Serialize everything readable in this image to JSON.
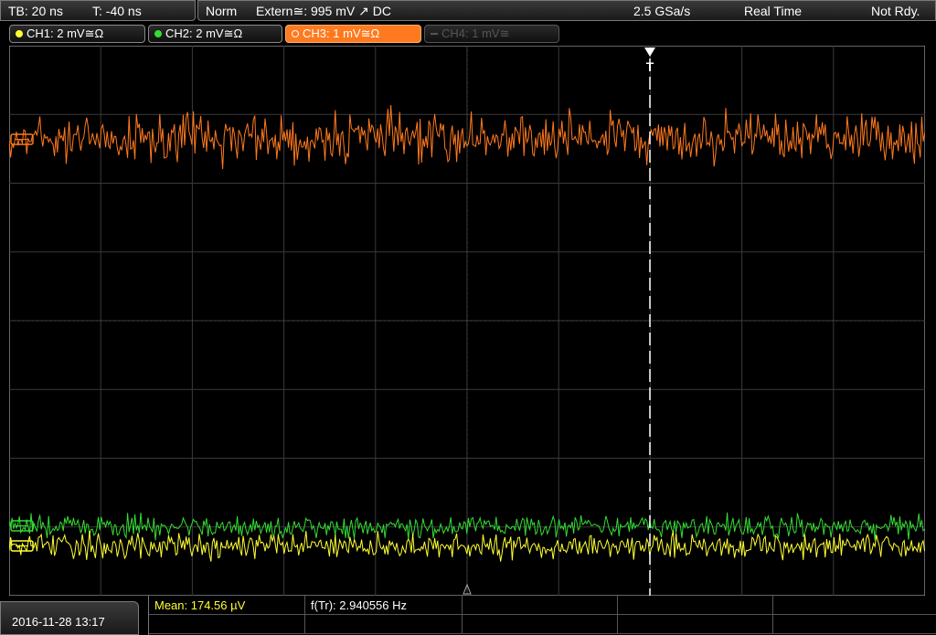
{
  "header": {
    "timebase": "TB: 20 ns",
    "trigger_time": "T: -40 ns",
    "mode": "Norm",
    "trigger_source": "Extern≅: 995 mV ↗ DC",
    "sample_rate": "2.5 GSa/s",
    "acquisition": "Real Time",
    "status": "Not Rdy."
  },
  "channels": [
    {
      "label": "CH1: 2 mV≅Ω",
      "color": "#ffff33",
      "state": "on"
    },
    {
      "label": "CH2: 2 mV≅Ω",
      "color": "#33dd33",
      "state": "on"
    },
    {
      "label": "CH3: 1 mV≅Ω",
      "color": "#ff7a1e",
      "state": "active"
    },
    {
      "label": "CH4: 1 mV≅",
      "color": "#555555",
      "state": "off"
    }
  ],
  "trigger_marker": "T",
  "footer": {
    "datetime": "2016-11-28  13:17",
    "mean": "Mean: 174.56 µV",
    "freq": "f(Tr): 2.940556 Hz"
  },
  "traces": [
    {
      "name": "CH3",
      "color": "#ff7a1e",
      "amplitude": "large"
    },
    {
      "name": "CH2",
      "color": "#33dd33",
      "amplitude": "small"
    },
    {
      "name": "CH1",
      "color": "#ffff33",
      "amplitude": "small"
    }
  ]
}
